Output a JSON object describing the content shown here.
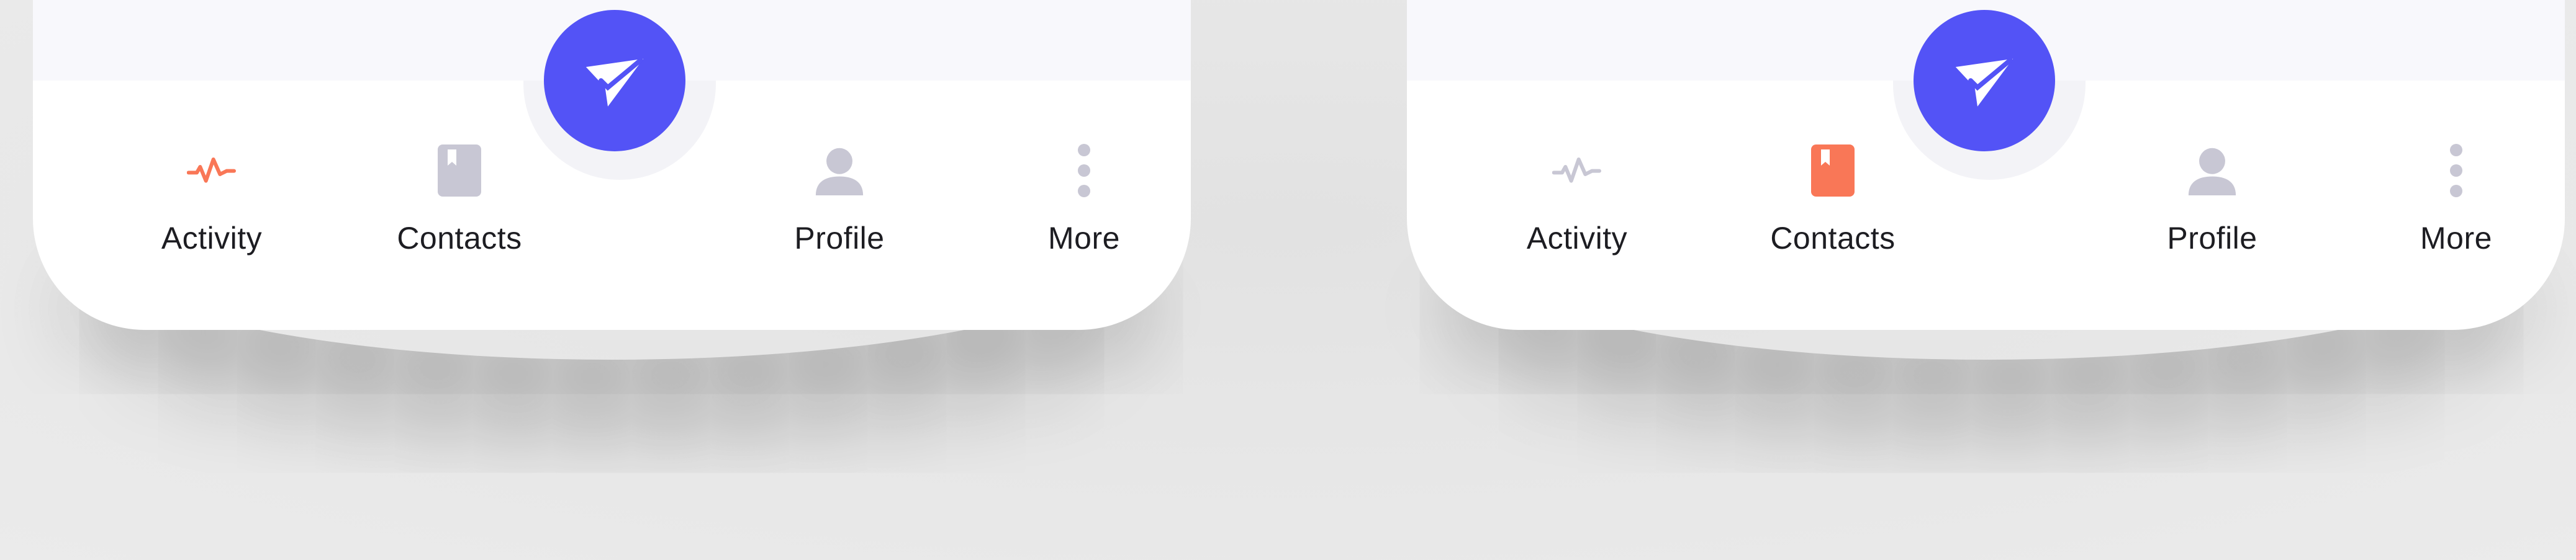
{
  "colors": {
    "accent": "#f97757",
    "inactive": "#c8c7d4",
    "fab": "#5353f6"
  },
  "panels": [
    {
      "active_tab": "activity",
      "tabs": [
        {
          "label": "Activity",
          "icon": "activity-icon"
        },
        {
          "label": "Contacts",
          "icon": "contacts-book-icon"
        },
        {
          "label": "Profile",
          "icon": "person-icon"
        },
        {
          "label": "More",
          "icon": "more-vertical-icon"
        }
      ],
      "fab_icon": "send-icon"
    },
    {
      "active_tab": "contacts",
      "tabs": [
        {
          "label": "Activity",
          "icon": "activity-icon"
        },
        {
          "label": "Contacts",
          "icon": "contacts-book-icon"
        },
        {
          "label": "Profile",
          "icon": "person-icon"
        },
        {
          "label": "More",
          "icon": "more-vertical-icon"
        }
      ],
      "fab_icon": "send-icon"
    }
  ]
}
